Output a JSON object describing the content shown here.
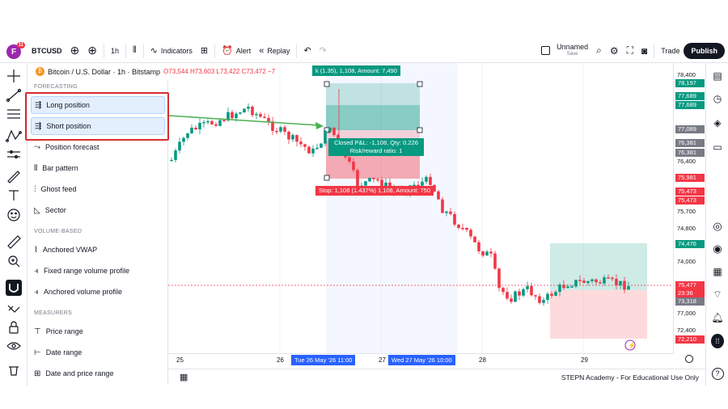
{
  "header": {
    "avatar_letter": "F",
    "avatar_badge": "11",
    "symbol": "BTCUSD",
    "interval": "1h",
    "indicators_label": "Indicators",
    "alert_label": "Alert",
    "replay_label": "Replay",
    "layout_name": "Unnamed",
    "layout_status": "Save",
    "trade_label": "Trade",
    "publish_label": "Publish"
  },
  "legend": {
    "title": "Bitcoin / U.S. Dollar · 1h · Bitstamp",
    "ohlc": "O73,544 H73,603 L73,422 C73,472 −7"
  },
  "drawing_menu": {
    "forecasting_title": "FORECASTING",
    "forecasting": [
      {
        "label": "Long position",
        "highlighted": true
      },
      {
        "label": "Short position",
        "highlighted": true
      },
      {
        "label": "Position forecast"
      },
      {
        "label": "Bar pattern"
      },
      {
        "label": "Ghost feed"
      },
      {
        "label": "Sector"
      }
    ],
    "volume_title": "VOLUME-BASED",
    "volume": [
      {
        "label": "Anchored VWAP"
      },
      {
        "label": "Fixed range volume profile"
      },
      {
        "label": "Anchored volume profile"
      }
    ],
    "measurers_title": "MEASURERS",
    "measurers": [
      {
        "label": "Price range"
      },
      {
        "label": "Date range"
      },
      {
        "label": "Date and price range"
      }
    ]
  },
  "position_tool": {
    "target_label": "k (1.35), 1,108, Amount: 7,490",
    "stats_line1": "Closed P&L: -1,108, Qty: 0.226",
    "stats_line2": "Risk/reward ratio: 1",
    "stop_label": "Stop: 1,108 (1.437%) 1,108, Amount: 750"
  },
  "price_scale": {
    "labels": [
      "78,400",
      "76,400",
      "75,700",
      "74,800",
      "74,000",
      "72,400",
      "77,000"
    ],
    "tags": [
      {
        "text": "78,197",
        "color": "#089981"
      },
      {
        "text": "77,689",
        "color": "#089981"
      },
      {
        "text": "77,689",
        "color": "#089981"
      },
      {
        "text": "77,089",
        "color": "#787b86"
      },
      {
        "text": "76,381",
        "color": "#787b86"
      },
      {
        "text": "76,381",
        "color": "#787b86"
      },
      {
        "text": "75,981",
        "color": "#f23645"
      },
      {
        "text": "75,473",
        "color": "#f23645"
      },
      {
        "text": "75,473",
        "color": "#f23645"
      },
      {
        "text": "74,476",
        "color": "#089981"
      },
      {
        "text": "75,477",
        "color": "#f23645"
      },
      {
        "text": "23:36",
        "color": "#f23645"
      },
      {
        "text": "73,318",
        "color": "#787b86"
      },
      {
        "text": "72,210",
        "color": "#f23645"
      }
    ]
  },
  "time_scale": {
    "labels": [
      "25",
      "26",
      "27",
      "28",
      "29"
    ],
    "range_start": "Tue 26 May '26   11:00",
    "range_end": "Wed 27 May '26   10:00"
  },
  "footer": {
    "text": "STEPN Academy - For Educational Use Only"
  },
  "colors": {
    "up": "#089981",
    "down": "#f23645",
    "accent": "#2962ff",
    "highlight_box": "#d32f2f"
  }
}
